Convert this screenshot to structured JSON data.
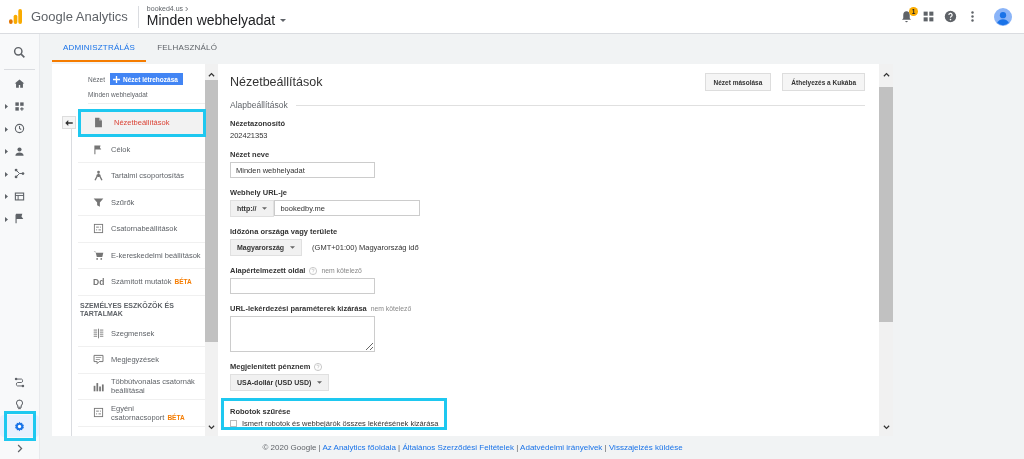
{
  "header": {
    "product": "Google Analytics",
    "breadcrumb": "booked4.us",
    "view": "Minden webhelyadat",
    "notifications": "1"
  },
  "rail": {
    "top_items": [
      {
        "expandable": false,
        "selected": false
      },
      {
        "expandable": false,
        "selected": false
      },
      {
        "expandable": true,
        "selected": false
      },
      {
        "expandable": true,
        "selected": false
      },
      {
        "expandable": true,
        "selected": false
      },
      {
        "expandable": true,
        "selected": false
      },
      {
        "expandable": true,
        "selected": false
      },
      {
        "expandable": true,
        "selected": false
      }
    ],
    "bottom_items": [
      {
        "selected": false,
        "highlighted": false
      },
      {
        "selected": false,
        "highlighted": false
      },
      {
        "selected": true,
        "highlighted": true
      },
      {
        "selected": false,
        "highlighted": false
      }
    ]
  },
  "tabs": [
    {
      "label": "ADMINISZTRÁLÁS",
      "selected": true
    },
    {
      "label": "FELHASZNÁLÓ",
      "selected": false
    }
  ],
  "nav": {
    "label": "Nézet",
    "create_button": "Nézet létrehozása",
    "current_view": "Minden webhelyadat",
    "items": [
      {
        "kind": "item",
        "label": "Nézetbeállítások",
        "selected": true,
        "highlighted": true
      },
      {
        "kind": "item",
        "label": "Célok",
        "selected": false,
        "highlighted": false
      },
      {
        "kind": "item",
        "label": "Tartalmi csoportosítás",
        "selected": false,
        "highlighted": false
      },
      {
        "kind": "item",
        "label": "Szűrők",
        "selected": false,
        "highlighted": false
      },
      {
        "kind": "item",
        "label": "Csatornabeállítások",
        "selected": false,
        "highlighted": false
      },
      {
        "kind": "item",
        "label": "E-kereskedelmi beállítások",
        "selected": false,
        "highlighted": false
      },
      {
        "kind": "item",
        "label": "Számított mutatók",
        "icon_text": "Dd",
        "badge": "BÉTA",
        "selected": false,
        "highlighted": false
      },
      {
        "kind": "section",
        "label": "SZEMÉLYES ESZKÖZÖK ÉS TARTALMAK"
      },
      {
        "kind": "item",
        "label": "Szegmensek",
        "selected": false,
        "highlighted": false
      },
      {
        "kind": "item",
        "label": "Megjegyzések",
        "selected": false,
        "highlighted": false
      },
      {
        "kind": "item",
        "label": "Többútvonalas csatornák beállításai",
        "selected": false,
        "highlighted": false
      },
      {
        "kind": "item",
        "label": "Egyéni csatornacsoport",
        "badge": "BÉTA",
        "selected": false,
        "highlighted": false
      }
    ]
  },
  "content": {
    "title": "Nézetbeállítások",
    "buttons": [
      "Nézet másolása",
      "Áthelyezés a Kukába"
    ],
    "section": "Alapbeállítások",
    "fields": [
      {
        "kind": "static",
        "label": "Nézetazonosító",
        "value": "202421353"
      },
      {
        "kind": "text",
        "label": "Nézet neve",
        "value": "Minden webhelyadat"
      },
      {
        "kind": "url",
        "label": "Webhely URL-je",
        "protocol": "http://",
        "value": "bookedby.me"
      },
      {
        "kind": "select",
        "label": "Időzóna országa vagy területe",
        "value": "Magyarország",
        "note": "(GMT+01:00) Magyarország idő"
      },
      {
        "kind": "text",
        "label": "Alapértelmezett oldal",
        "help": true,
        "optional": "nem kötelező"
      },
      {
        "kind": "textarea",
        "label": "URL-lekérdezési paraméterek kizárása",
        "optional": "nem kötelező"
      },
      {
        "kind": "select",
        "label": "Megjelenített pénznem",
        "help": true,
        "value": "USA-dollár (USD USD)"
      },
      {
        "kind": "checkbox",
        "label": "Robotok szűrése",
        "text": "Ismert robotok és webbejárók összes lekérésének kizárása",
        "checked": false,
        "highlighted": true
      }
    ]
  },
  "footer": [
    {
      "kind": "text",
      "text": "© 2020 Google"
    },
    {
      "kind": "separator",
      "text": "|"
    },
    {
      "kind": "link",
      "text": "Az Analytics főoldala"
    },
    {
      "kind": "separator",
      "text": "|"
    },
    {
      "kind": "link",
      "text": "Általános Szerződési Feltételek"
    },
    {
      "kind": "separator",
      "text": "|"
    },
    {
      "kind": "link",
      "text": "Adatvédelmi irányelvek"
    },
    {
      "kind": "separator",
      "text": "|"
    },
    {
      "kind": "link",
      "text": "Visszajelzés küldése"
    }
  ]
}
